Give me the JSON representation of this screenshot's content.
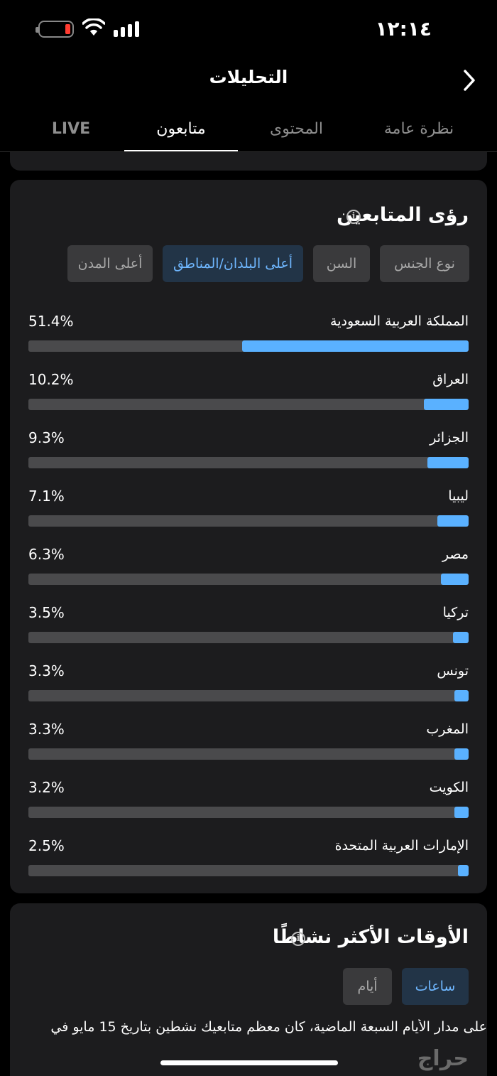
{
  "status_bar": {
    "time": "١٢:١٤"
  },
  "header": {
    "title": "التحليلات"
  },
  "tabs": [
    {
      "label": "LIVE"
    },
    {
      "label": "متابعون"
    },
    {
      "label": "المحتوى"
    },
    {
      "label": "نظرة عامة"
    }
  ],
  "audience": {
    "title": "رؤى المتابعين",
    "filters": [
      {
        "label": "نوع الجنس"
      },
      {
        "label": "السن"
      },
      {
        "label": "أعلى البلدان/المناطق"
      },
      {
        "label": "أعلى المدن"
      }
    ],
    "rows": [
      {
        "label": "المملكة العربية السعودية",
        "percent": "51.4%",
        "value": 51.4
      },
      {
        "label": "العراق",
        "percent": "10.2%",
        "value": 10.2
      },
      {
        "label": "الجزائر",
        "percent": "9.3%",
        "value": 9.3
      },
      {
        "label": "ليبيا",
        "percent": "7.1%",
        "value": 7.1
      },
      {
        "label": "مصر",
        "percent": "6.3%",
        "value": 6.3
      },
      {
        "label": "تركيا",
        "percent": "3.5%",
        "value": 3.5
      },
      {
        "label": "تونس",
        "percent": "3.3%",
        "value": 3.3
      },
      {
        "label": "المغرب",
        "percent": "3.3%",
        "value": 3.3
      },
      {
        "label": "الكويت",
        "percent": "3.2%",
        "value": 3.2
      },
      {
        "label": "الإمارات العربية المتحدة",
        "percent": "2.5%",
        "value": 2.5
      }
    ]
  },
  "active_times": {
    "title": "الأوقات الأكثر نشاطًا",
    "toggle_hours": "ساعات",
    "toggle_days": "أيام",
    "description": "على مدار الأيام السبعة الماضية، كان معظم متابعيك نشطين بتاريخ 15 مايو في"
  },
  "watermark": "حراج",
  "colors": {
    "accent": "#5ab1ff",
    "card": "#1c1c1e",
    "track": "#4a4a4c",
    "background": "#000000"
  }
}
